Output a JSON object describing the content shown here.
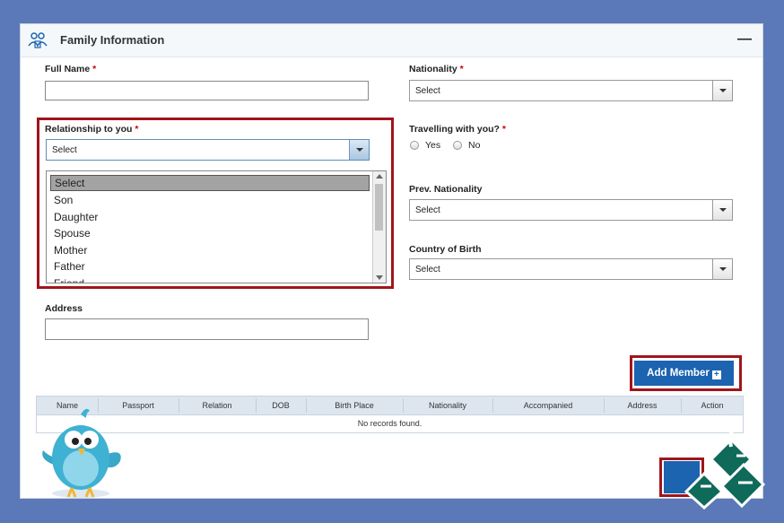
{
  "panel": {
    "title": "Family Information",
    "collapse_symbol": "—"
  },
  "fields": {
    "full_name": {
      "label": "Full Name",
      "value": ""
    },
    "nationality": {
      "label": "Nationality",
      "value": "Select"
    },
    "relationship": {
      "label": "Relationship to you",
      "value": "Select"
    },
    "travelling": {
      "label": "Travelling with you?",
      "options": [
        "Yes",
        "No"
      ]
    },
    "prev_nationality": {
      "label": "Prev. Nationality",
      "value": "Select"
    },
    "country_of_birth": {
      "label": "Country of Birth",
      "value": "Select"
    },
    "address": {
      "label": "Address",
      "value": ""
    },
    "required_mark": "*"
  },
  "relationship_options": [
    "Select",
    "Son",
    "Daughter",
    "Spouse",
    "Mother",
    "Father",
    "Friend"
  ],
  "add_member": {
    "label": "Add Member",
    "icon": "plus-icon"
  },
  "table": {
    "columns": [
      "Name",
      "Passport",
      "Relation",
      "DOB",
      "Birth Place",
      "Nationality",
      "Accompanied",
      "Address",
      "Action"
    ],
    "empty_message": "No records found."
  },
  "colors": {
    "accent_blue": "#1c63b0",
    "highlight_red": "#a0151b",
    "background": "#5b78b8"
  }
}
